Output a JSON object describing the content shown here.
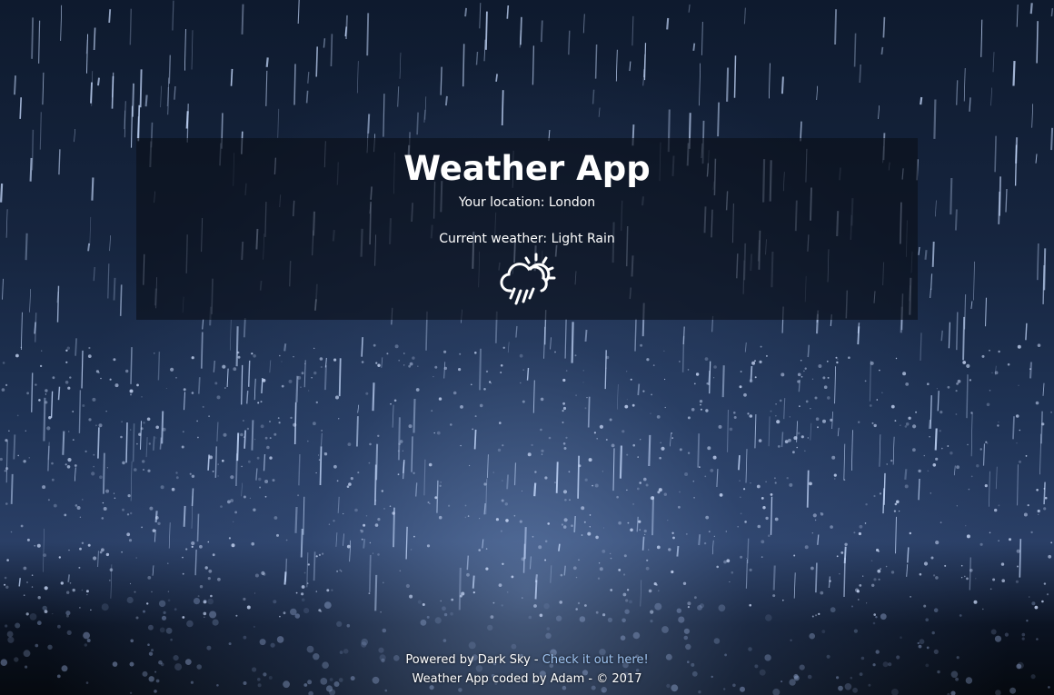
{
  "app": {
    "title": "Weather App"
  },
  "location": {
    "label": "Your location: London"
  },
  "weather": {
    "label": "Current weather: Light Rain",
    "icon": "cloud-rain-sun-icon"
  },
  "footer": {
    "powered_by": "Powered by Dark Sky - ",
    "link_text": "Check it out here!",
    "credits": "Weather App coded by Adam - © 2017"
  },
  "colors": {
    "panel": "#0a0e18",
    "link": "#9ec3f0",
    "text": "#ffffff"
  }
}
